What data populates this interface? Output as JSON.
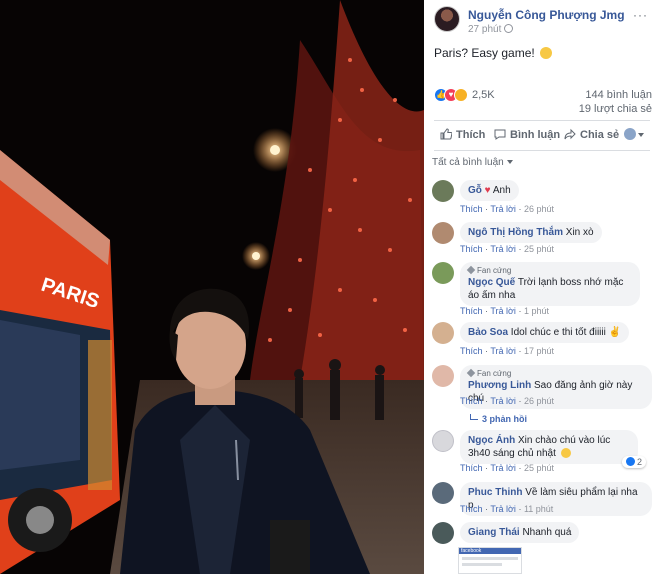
{
  "post": {
    "author": "Nguyễn Công Phượng Jmg",
    "time": "27 phút",
    "more": "···",
    "text": "Paris? Easy game!",
    "reactions_count": "2,5K",
    "comments_count": "144 bình luận",
    "shares_count": "19 lượt chia sẻ"
  },
  "actions": {
    "like": "Thích",
    "comment": "Bình luận",
    "share": "Chia sẻ"
  },
  "filter_label": "Tất cả bình luận",
  "comments": [
    {
      "name": "Gỗ",
      "text": "Anh",
      "like": "Thích",
      "reply": "Trả lời",
      "time": "26 phút"
    },
    {
      "name": "Ngô Thị Hồng Thắm",
      "text": "Xin xò",
      "like": "Thích",
      "reply": "Trả lời",
      "time": "25 phút"
    },
    {
      "fan": "Fan cứng",
      "name": "Ngọc Quế",
      "text": "Trời lạnh boss nhớ mặc áo ấm nha",
      "like": "Thích",
      "reply": "Trả lời",
      "time": "1 phút"
    },
    {
      "name": "Bảo Soa",
      "text": "Idol chúc e thi tốt điiiii",
      "like": "Thích",
      "reply": "Trả lời",
      "time": "17 phút"
    },
    {
      "fan": "Fan cứng",
      "name": "Phương Linh",
      "text": "Sao đăng ảnh giờ này chú",
      "like": "Thích",
      "reply": "Trả lời",
      "time": "26 phút",
      "replies": "3 phản hồi"
    },
    {
      "name": "Ngọc Ánh",
      "text": "Xin chào chú vào lúc 3h40 sáng chủ nhật",
      "like": "Thích",
      "reply": "Trả lời",
      "time": "25 phút",
      "likes": "2"
    },
    {
      "name": "Phuc Thinh",
      "text": "Về làm siêu phẩm lại nha p",
      "like": "Thích",
      "reply": "Trả lời",
      "time": "11 phút"
    },
    {
      "name": "Giang Thái",
      "text": "Nhanh quá"
    }
  ],
  "thumbnail_label": "facebook",
  "colors": {
    "link": "#385898",
    "meta": "#606770",
    "like_blue": "#1877f2",
    "love_red": "#f33e58",
    "haha_yellow": "#f7b125",
    "bubble": "#f2f3f5"
  }
}
